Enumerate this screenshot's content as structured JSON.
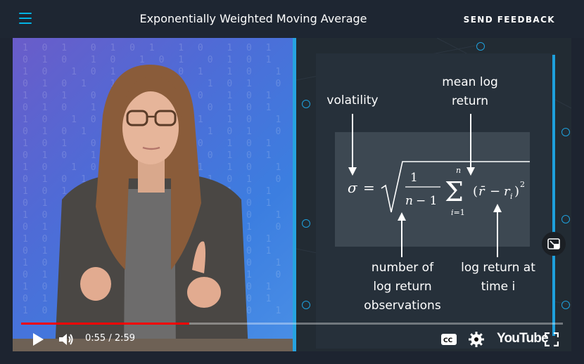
{
  "header": {
    "title": "Exponentially Weighted Moving Average",
    "feedback_label": "SEND FEEDBACK"
  },
  "slide": {
    "label_volatility": "volatility",
    "label_mean_1": "mean log",
    "label_mean_2": "return",
    "label_num_1": "number of",
    "label_num_2": "log return",
    "label_num_3": "observations",
    "label_logret_1": "log return at",
    "label_logret_2": "time i"
  },
  "player": {
    "time": "0:55 / 2:59",
    "brand": "YouTube",
    "progress": 0.31
  },
  "colors": {
    "accent": "#02b3e4",
    "progress": "#ff0000"
  }
}
